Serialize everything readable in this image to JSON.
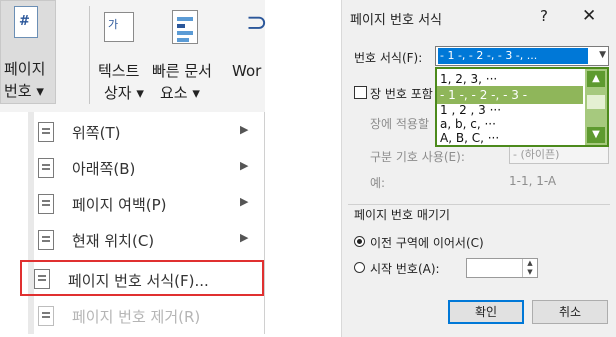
{
  "ribbon": {
    "page_number_icon_glyph": "#",
    "page_number_label_1": "페이지",
    "page_number_label_2": "번호 ▾",
    "textbox_label_1": "텍스트",
    "textbox_label_2": "상자 ▾",
    "textbox_icon_glyph": "가",
    "quickparts_label_1": "빠른 문서",
    "quickparts_label_2": "요소 ▾",
    "wordart_label": "Wor"
  },
  "menu": {
    "items": [
      {
        "label": "위쪽(T)",
        "has_submenu": true,
        "arrow": "▶"
      },
      {
        "label": "아래쪽(B)",
        "has_submenu": true,
        "arrow": "▶"
      },
      {
        "label": "페이지 여백(P)",
        "has_submenu": true,
        "arrow": "▶"
      },
      {
        "label": "현재 위치(C)",
        "has_submenu": true,
        "arrow": "▶"
      },
      {
        "label": "페이지 번호 서식(F)...",
        "has_submenu": false,
        "highlighted": true
      },
      {
        "label": "페이지 번호 제거(R)",
        "has_submenu": false,
        "disabled": true
      }
    ]
  },
  "dialog": {
    "title": "페이지 번호 서식",
    "help": "?",
    "close": "✕",
    "number_format_label": "번호 서식(F):",
    "number_format_value": "- 1 -, - 2 -, - 3 -, ...",
    "dropdown_arrow": "▼",
    "dropdown_options": [
      {
        "label": "1, 2, 3, ···",
        "selected": false
      },
      {
        "label": "- 1 -, - 2 -, - 3 -",
        "selected": true
      },
      {
        "label": "1 , 2 , 3 ···",
        "selected": false
      },
      {
        "label": "a, b, c, ···",
        "selected": false
      },
      {
        "label": "A, B, C, ···",
        "selected": false
      }
    ],
    "include_chapter_label": "장 번호 포함",
    "chapter_style_label": "장에 적용할",
    "separator_label": "구분 기호 사용(E):",
    "separator_value": "- (하이픈)",
    "example_label": "예:",
    "example_value": "1-1, 1-A",
    "numbering_group_label": "페이지 번호 매기기",
    "continue_label": "이전 구역에 이어서(C)",
    "start_at_label": "시작 번호(A):",
    "start_at_value": "",
    "ok_button": "확인",
    "cancel_button": "취소"
  },
  "colors": {
    "selection_blue": "#0078d7",
    "highlight_red": "#e03030",
    "dropdown_green": "#8fb65a"
  }
}
